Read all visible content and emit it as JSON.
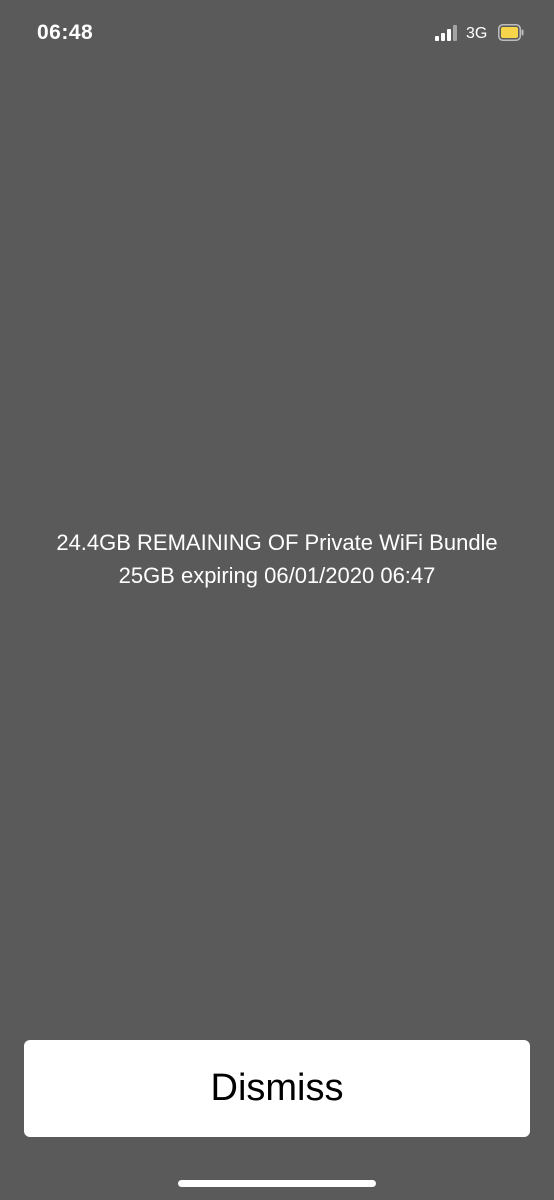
{
  "status_bar": {
    "time": "06:48",
    "network": "3G",
    "signal_icon": "cellular-signal-icon",
    "battery_icon": "battery-icon",
    "battery_color": "#f7d54a"
  },
  "message": {
    "line1": "24.4GB REMAINING OF Private WiFi Bundle",
    "line2": "25GB expiring 06/01/2020 06:47"
  },
  "dismiss_button": {
    "label": "Dismiss"
  },
  "colors": {
    "background": "#5a5a5a",
    "button_background": "#ffffff",
    "text": "#ffffff"
  }
}
